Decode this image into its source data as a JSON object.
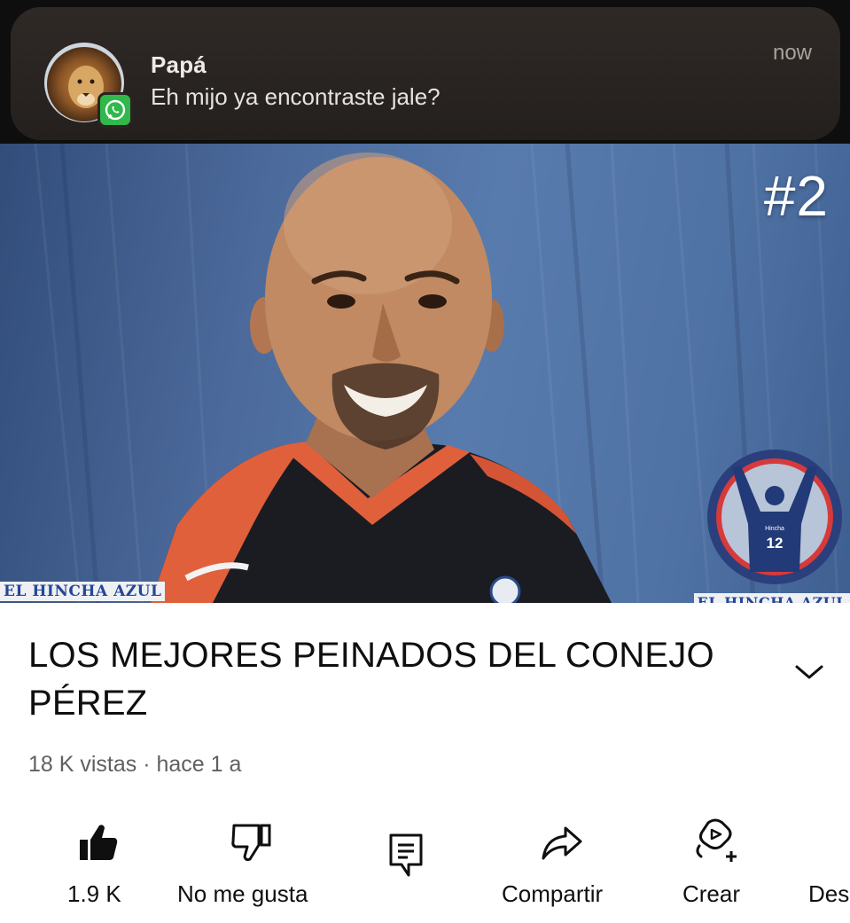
{
  "notification": {
    "sender": "Papá",
    "message": "Eh mijo ya encontraste jale?",
    "time": "now",
    "app_icon": "whatsapp-icon",
    "avatar": "lion-avatar"
  },
  "video": {
    "thumbnail_number": "#2",
    "watermark_left": "EL HINCHA AZUL",
    "watermark_right": "EL HINCHA AZUL",
    "logo_text": "Hincha",
    "logo_jersey_number": "12",
    "title": "LOS MEJORES PEINADOS DEL CONEJO PÉREZ",
    "views": "18 K vistas",
    "separator": " · ",
    "age": "hace 1 a"
  },
  "actions": [
    {
      "label": "1.9 K",
      "icon": "thumbs-up-filled-icon"
    },
    {
      "label": "No me gusta",
      "icon": "thumbs-down-icon"
    },
    {
      "label": "",
      "icon": "comment-icon"
    },
    {
      "label": "Compartir",
      "icon": "share-icon"
    },
    {
      "label": "Crear",
      "icon": "create-remix-icon"
    },
    {
      "label": "Des",
      "icon": "download-icon"
    }
  ],
  "colors": {
    "notification_bg": "#2a2421",
    "whatsapp_green": "#30b84a",
    "thumbnail_blue": "#4f72a4",
    "watermark_blue": "#24469a",
    "text_primary": "#0f0f0f",
    "text_secondary": "#606060"
  }
}
